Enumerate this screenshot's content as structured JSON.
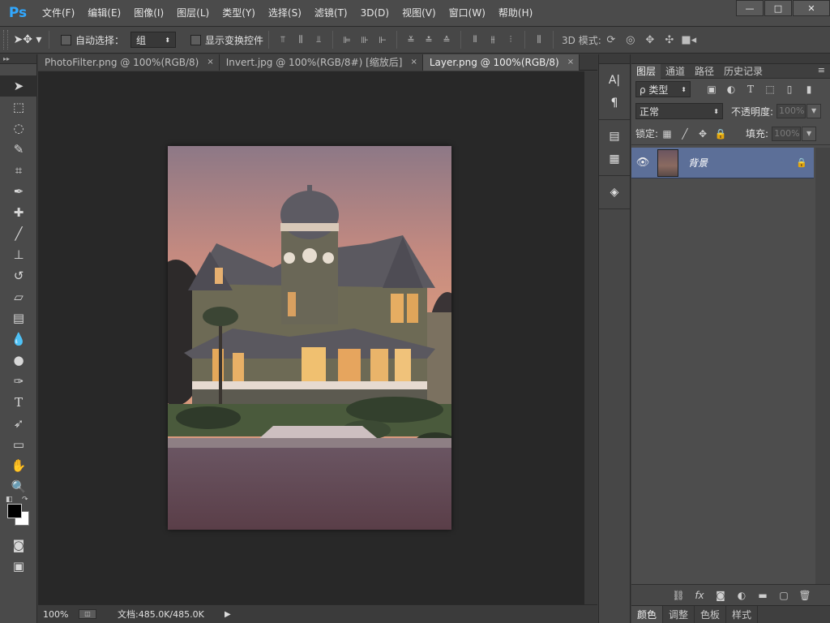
{
  "app": {
    "logo": "Ps"
  },
  "menu": [
    "文件(F)",
    "编辑(E)",
    "图像(I)",
    "图层(L)",
    "类型(Y)",
    "选择(S)",
    "滤镜(T)",
    "3D(D)",
    "视图(V)",
    "窗口(W)",
    "帮助(H)"
  ],
  "window_controls": {
    "minimize": "—",
    "restore": "□",
    "close": "✕"
  },
  "options": {
    "auto_select_label": "自动选择：",
    "auto_select_value": "组",
    "show_transform_label": "显示变换控件",
    "mode_3d_label": "3D 模式:"
  },
  "tabs": [
    {
      "label": "PhotoFilter.png @ 100%(RGB/8)",
      "close": "×"
    },
    {
      "label": "Invert.jpg @ 100%(RGB/8#) [缩放后]",
      "close": "×"
    },
    {
      "label": "Layer.png @ 100%(RGB/8)",
      "close": "×"
    }
  ],
  "status": {
    "zoom": "100%",
    "doc_info": "文档:485.0K/485.0K"
  },
  "layers_panel": {
    "tabs": [
      "图层",
      "通道",
      "路径",
      "历史记录"
    ],
    "filter_label": "ρ 类型",
    "blend_mode": "正常",
    "opacity_label": "不透明度:",
    "opacity_value": "100%",
    "lock_label": "锁定:",
    "fill_label": "填充:",
    "fill_value": "100%",
    "layer_name": "背景"
  },
  "bottom_tabs": [
    "颜色",
    "调整",
    "色板",
    "样式"
  ],
  "colors": {
    "foreground": "#000000",
    "background": "#ffffff",
    "selected_layer": "#5c6f98"
  }
}
